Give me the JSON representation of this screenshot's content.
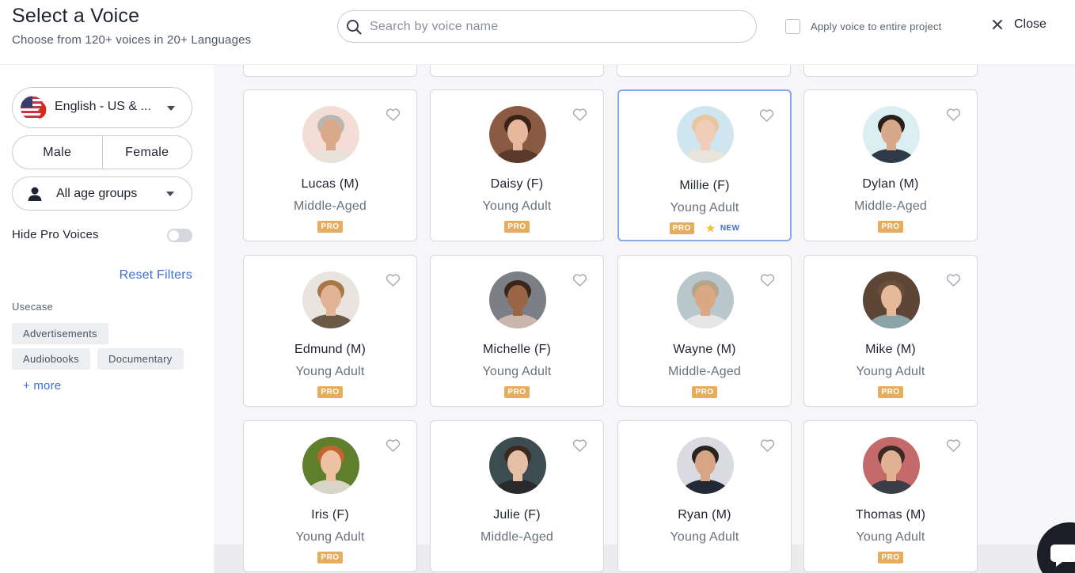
{
  "header": {
    "title": "Select a Voice",
    "subtitle": "Choose from 120+ voices in 20+ Languages",
    "search_placeholder": "Search by voice name",
    "apply_label": "Apply voice to entire project",
    "close_label": "Close"
  },
  "sidebar": {
    "language": "English - US & ...",
    "gender_male": "Male",
    "gender_female": "Female",
    "age_label": "All age groups",
    "hide_pro_label": "Hide Pro Voices",
    "hide_pro_on": false,
    "reset_label": "Reset Filters",
    "usecase_heading": "Usecase",
    "usecase_tags": [
      "Advertisements",
      "Audiobooks",
      "Documentary"
    ],
    "more_label": "+ more"
  },
  "badges": {
    "pro": "PRO",
    "new": "NEW"
  },
  "voices": [
    {
      "name": "Lucas (M)",
      "age": "Middle-Aged",
      "pro": true,
      "new": false,
      "bg": "#f4ddd6",
      "skin": "#d9a98a",
      "hair": "#b9b6b2",
      "shirt": "#e8e2d8"
    },
    {
      "name": "Daisy (F)",
      "age": "Young Adult",
      "pro": true,
      "new": false,
      "bg": "#8a5a42",
      "skin": "#e8b89c",
      "hair": "#3a2418",
      "shirt": "#5a3a2c"
    },
    {
      "name": "Millie (F)",
      "age": "Young Adult",
      "pro": true,
      "new": true,
      "bg": "#cfe6f0",
      "skin": "#f0cdb8",
      "hair": "#e6c7a0",
      "shirt": "#e8e4dc"
    },
    {
      "name": "Dylan (M)",
      "age": "Middle-Aged",
      "pro": true,
      "new": false,
      "bg": "#dbeef2",
      "skin": "#d7a88a",
      "hair": "#2a1f1a",
      "shirt": "#2f3a48"
    },
    {
      "name": "Edmund (M)",
      "age": "Young Adult",
      "pro": true,
      "new": false,
      "bg": "#e9e4de",
      "skin": "#e1b496",
      "hair": "#a7774a",
      "shirt": "#6b5a48"
    },
    {
      "name": "Michelle (F)",
      "age": "Young Adult",
      "pro": true,
      "new": false,
      "bg": "#7d7f86",
      "skin": "#9a6546",
      "hair": "#3b2519",
      "shirt": "#c9b7ae"
    },
    {
      "name": "Wayne (M)",
      "age": "Middle-Aged",
      "pro": true,
      "new": false,
      "bg": "#b9c6cc",
      "skin": "#dba884",
      "hair": "#b8a487",
      "shirt": "#e6e6e6"
    },
    {
      "name": "Mike (M)",
      "age": "Young Adult",
      "pro": true,
      "new": false,
      "bg": "#5d4636",
      "skin": "#e6b99b",
      "hair": "#6b4e36",
      "shirt": "#8ca3a8"
    },
    {
      "name": "Iris (F)",
      "age": "Young Adult",
      "pro": true,
      "new": false,
      "bg": "#5f7f2c",
      "skin": "#ecc2a2",
      "hair": "#c2652e",
      "shirt": "#d8d4c8"
    },
    {
      "name": "Julie (F)",
      "age": "Middle-Aged",
      "pro": false,
      "new": false,
      "bg": "#3d4c50",
      "skin": "#e4bea5",
      "hair": "#3a2a22",
      "shirt": "#2a2a2e"
    },
    {
      "name": "Ryan (M)",
      "age": "Young Adult",
      "pro": false,
      "new": false,
      "bg": "#d9dbe0",
      "skin": "#d7a486",
      "hair": "#2b231e",
      "shirt": "#222a38"
    },
    {
      "name": "Thomas (M)",
      "age": "Young Adult",
      "pro": true,
      "new": false,
      "bg": "#c56a6a",
      "skin": "#e2b193",
      "hair": "#3b2b22",
      "shirt": "#3a3e48"
    }
  ],
  "selected_voice": "Millie (F)",
  "colors": {
    "accent": "#3c6fd1",
    "pro_badge": "#e6ad5c",
    "selected_border": "#8aa8ec"
  }
}
